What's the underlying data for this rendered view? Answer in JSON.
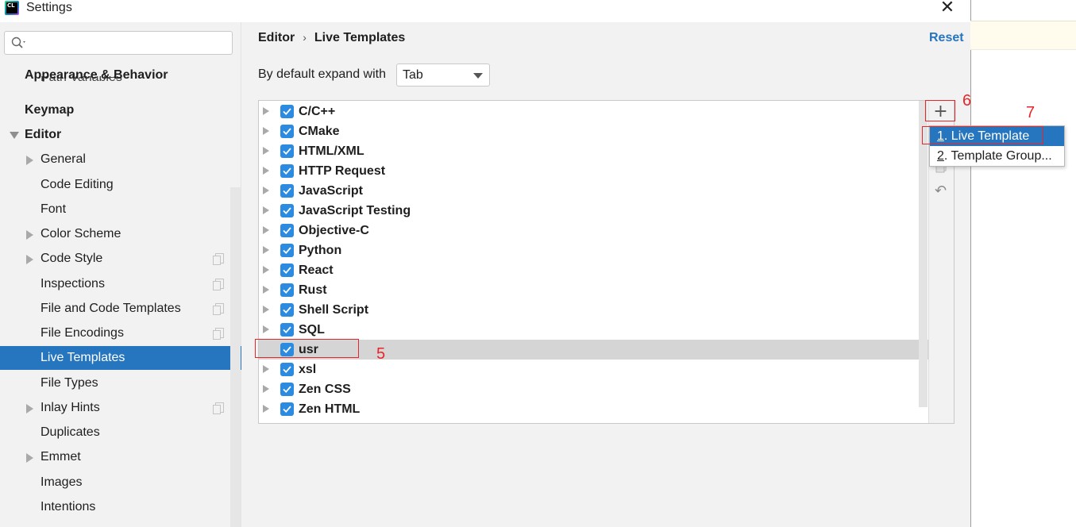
{
  "window": {
    "title": "Settings",
    "app_logo_text": "CL",
    "close_glyph": "✕"
  },
  "search": {
    "placeholder": "",
    "value": ""
  },
  "sidebar": {
    "partial_item": "Path Variables",
    "items": [
      {
        "label": "Appearance & Behavior",
        "bold": true
      },
      {
        "label": "Keymap",
        "bold": true
      },
      {
        "label": "Editor",
        "bold": true,
        "expanded": true
      },
      {
        "label": "General",
        "expandable": true
      },
      {
        "label": "Code Editing"
      },
      {
        "label": "Font"
      },
      {
        "label": "Color Scheme",
        "expandable": true
      },
      {
        "label": "Code Style",
        "expandable": true,
        "copy_icon": true
      },
      {
        "label": "Inspections",
        "copy_icon": true
      },
      {
        "label": "File and Code Templates",
        "copy_icon": true
      },
      {
        "label": "File Encodings",
        "copy_icon": true
      },
      {
        "label": "Live Templates",
        "selected": true
      },
      {
        "label": "File Types"
      },
      {
        "label": "Inlay Hints",
        "expandable": true,
        "copy_icon": true
      },
      {
        "label": "Duplicates"
      },
      {
        "label": "Emmet",
        "expandable": true
      },
      {
        "label": "Images"
      },
      {
        "label": "Intentions"
      }
    ]
  },
  "header": {
    "breadcrumb": [
      "Editor",
      "Live Templates"
    ],
    "breadcrumb_sep": "›",
    "reset_label": "Reset"
  },
  "expand": {
    "label": "By default expand with",
    "value": "Tab"
  },
  "templates": [
    {
      "label": "C/C++",
      "checked": true,
      "expandable": true
    },
    {
      "label": "CMake",
      "checked": true,
      "expandable": true
    },
    {
      "label": "HTML/XML",
      "checked": true,
      "expandable": true
    },
    {
      "label": "HTTP Request",
      "checked": true,
      "expandable": true
    },
    {
      "label": "JavaScript",
      "checked": true,
      "expandable": true
    },
    {
      "label": "JavaScript Testing",
      "checked": true,
      "expandable": true
    },
    {
      "label": "Objective-C",
      "checked": true,
      "expandable": true
    },
    {
      "label": "Python",
      "checked": true,
      "expandable": true
    },
    {
      "label": "React",
      "checked": true,
      "expandable": true
    },
    {
      "label": "Rust",
      "checked": true,
      "expandable": true
    },
    {
      "label": "Shell Script",
      "checked": true,
      "expandable": true
    },
    {
      "label": "SQL",
      "checked": true,
      "expandable": true
    },
    {
      "label": "usr",
      "checked": true,
      "expandable": false,
      "highlighted": true
    },
    {
      "label": "xsl",
      "checked": true,
      "expandable": true
    },
    {
      "label": "Zen CSS",
      "checked": true,
      "expandable": true
    },
    {
      "label": "Zen HTML",
      "checked": true,
      "expandable": true
    }
  ],
  "toolbar": {
    "add_glyph": "+",
    "undo_glyph": "↶"
  },
  "popup": {
    "items": [
      {
        "mnemonic": "1",
        "label": ". Live Template",
        "active": true
      },
      {
        "mnemonic": "2",
        "label": ". Template Group...",
        "active": false
      }
    ]
  },
  "annotations": {
    "n5": "5",
    "n6": "6",
    "n7": "7",
    "color": "#e8262a"
  },
  "colors": {
    "accent": "#2675bf",
    "checkbox": "#2b8be0",
    "selection": "#2675bf",
    "row_highlight": "#d5d5d5"
  }
}
